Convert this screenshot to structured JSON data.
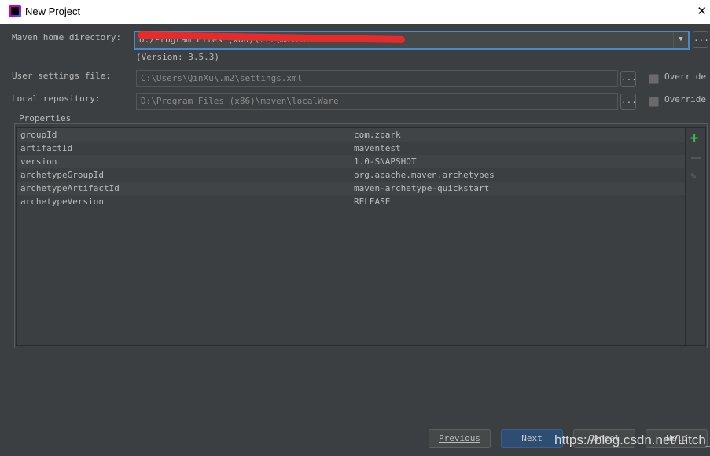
{
  "window": {
    "title": "New Project",
    "close_icon": "close-icon"
  },
  "maven_home": {
    "label": "Maven home directory:",
    "value": "D:/Program Files (x86)\\...\\maven-3.5.3",
    "version": "(Version: 3.5.3)"
  },
  "user_settings": {
    "label": "User settings file:",
    "value": "C:\\Users\\QinXu\\.m2\\settings.xml",
    "override": "Override",
    "override_checked": false
  },
  "local_repo": {
    "label": "Local repository:",
    "value": "D:\\Program Files (x86)\\maven\\localWare",
    "override": "Override",
    "override_checked": false
  },
  "browse_label": "...",
  "properties": {
    "title": "Properties",
    "rows": [
      {
        "key": "groupId",
        "value": "com.zpark"
      },
      {
        "key": "artifactId",
        "value": "maventest"
      },
      {
        "key": "version",
        "value": "1.0-SNAPSHOT"
      },
      {
        "key": "archetypeGroupId",
        "value": "org.apache.maven.archetypes"
      },
      {
        "key": "archetypeArtifactId",
        "value": "maven-archetype-quickstart"
      },
      {
        "key": "archetypeVersion",
        "value": "RELEASE"
      }
    ]
  },
  "buttons": {
    "previous": "Previous",
    "next": "Next",
    "cancel": "Cancel",
    "help": "Help"
  },
  "watermark": "https://blog.csdn.net/Litch_",
  "colors": {
    "accent": "#4a88c7",
    "add": "#3fb950",
    "primary_button": "#2e4d72"
  }
}
